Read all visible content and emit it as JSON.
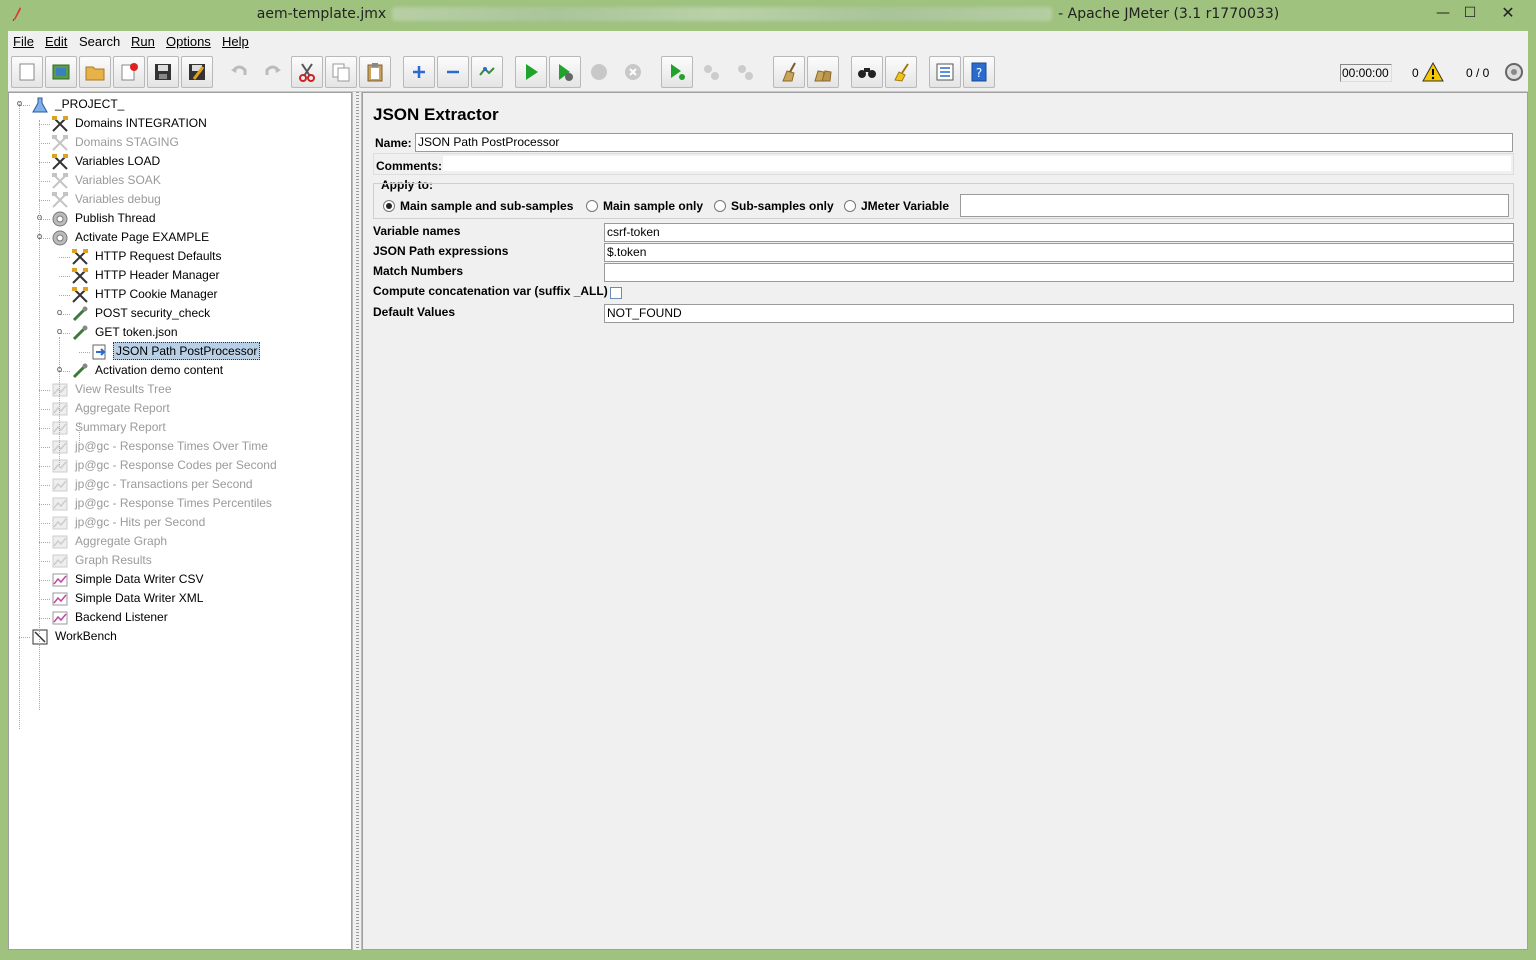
{
  "window": {
    "title_file": "aem-template.jmx",
    "title_app": "- Apache JMeter (3.1 r1770033)",
    "min": "—",
    "max": "☐",
    "close": "✕"
  },
  "menu": {
    "file": "File",
    "edit": "Edit",
    "search": "Search",
    "run": "Run",
    "options": "Options",
    "help": "Help"
  },
  "toolbar": {
    "timer": "00:00:00",
    "error_count": "0",
    "threads": "0 / 0"
  },
  "tree": [
    {
      "label": "_PROJECT_",
      "icon": "flask-icon",
      "disabled": false
    },
    {
      "label": "Domains INTEGRATION",
      "icon": "config-scissors-icon",
      "disabled": false
    },
    {
      "label": "Domains STAGING",
      "icon": "config-scissors-icon",
      "disabled": true
    },
    {
      "label": "Variables LOAD",
      "icon": "config-scissors-icon",
      "disabled": false
    },
    {
      "label": "Variables SOAK",
      "icon": "config-scissors-icon",
      "disabled": true
    },
    {
      "label": "Variables debug",
      "icon": "config-scissors-icon",
      "disabled": true
    },
    {
      "label": "Publish Thread",
      "icon": "gear-icon",
      "disabled": false
    },
    {
      "label": "Activate Page EXAMPLE",
      "icon": "gear-icon",
      "disabled": false
    },
    {
      "label": "HTTP Request Defaults",
      "icon": "config-scissors-icon",
      "disabled": false
    },
    {
      "label": "HTTP Header Manager",
      "icon": "config-scissors-icon",
      "disabled": false
    },
    {
      "label": "HTTP Cookie Manager",
      "icon": "config-scissors-icon",
      "disabled": false
    },
    {
      "label": "POST security_check",
      "icon": "pipette-icon",
      "disabled": false
    },
    {
      "label": "GET  token.json",
      "icon": "pipette-icon",
      "disabled": false
    },
    {
      "label": "JSON Path PostProcessor",
      "icon": "post-processor-icon",
      "disabled": false,
      "selected": true
    },
    {
      "label": "Activation demo content",
      "icon": "pipette-icon",
      "disabled": false
    },
    {
      "label": "View Results Tree",
      "icon": "listener-icon",
      "disabled": true
    },
    {
      "label": "Aggregate Report",
      "icon": "listener-icon",
      "disabled": true
    },
    {
      "label": "Summary Report",
      "icon": "listener-icon",
      "disabled": true
    },
    {
      "label": "jp@gc - Response Times Over Time",
      "icon": "listener-icon",
      "disabled": true
    },
    {
      "label": "jp@gc - Response Codes per Second",
      "icon": "listener-icon",
      "disabled": true
    },
    {
      "label": "jp@gc - Transactions per Second",
      "icon": "listener-icon",
      "disabled": true
    },
    {
      "label": "jp@gc - Response Times Percentiles",
      "icon": "listener-icon",
      "disabled": true
    },
    {
      "label": "jp@gc - Hits per Second",
      "icon": "listener-icon",
      "disabled": true
    },
    {
      "label": "Aggregate Graph",
      "icon": "listener-icon",
      "disabled": true
    },
    {
      "label": "Graph Results",
      "icon": "listener-icon",
      "disabled": true
    },
    {
      "label": "Simple Data Writer CSV",
      "icon": "listener-icon",
      "disabled": false
    },
    {
      "label": "Simple Data Writer XML",
      "icon": "listener-icon",
      "disabled": false
    },
    {
      "label": "Backend Listener",
      "icon": "listener-icon",
      "disabled": false
    },
    {
      "label": "WorkBench",
      "icon": "workbench-icon",
      "disabled": false
    }
  ],
  "panel": {
    "title": "JSON Extractor",
    "name_label": "Name:",
    "name_value": "JSON Path PostProcessor",
    "comments_label": "Comments:",
    "apply_to_label": "Apply to:",
    "radio_main_sub": "Main sample and sub-samples",
    "radio_main_only": "Main sample only",
    "radio_sub_only": "Sub-samples only",
    "radio_jmeter_var": "JMeter Variable",
    "radio_selected": "main_sub",
    "jmeter_var_value": "",
    "variable_names_label": "Variable names",
    "variable_names_value": "csrf-token",
    "json_path_label": "JSON Path expressions",
    "json_path_value": "$.token",
    "match_numbers_label": "Match Numbers",
    "match_numbers_value": "",
    "concat_label": "Compute concatenation var (suffix _ALL)",
    "concat_checked": false,
    "default_values_label": "Default Values",
    "default_values_value": "NOT_FOUND"
  }
}
